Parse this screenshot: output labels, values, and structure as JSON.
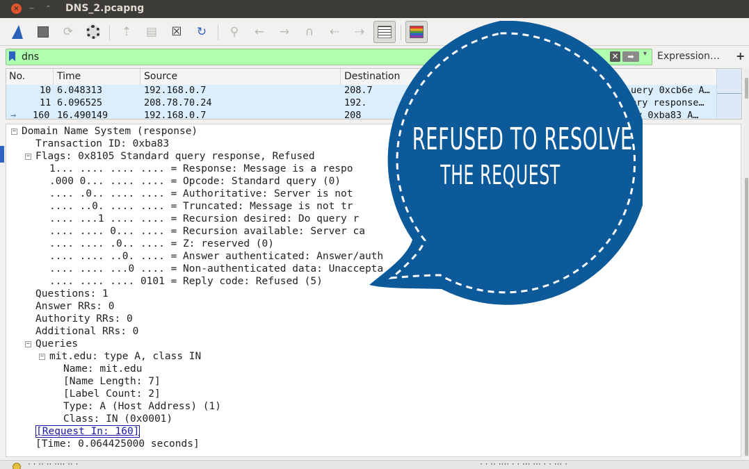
{
  "window": {
    "title": "DNS_2.pcapng",
    "close_glyph": "×",
    "min_glyph": "−",
    "max_glyph": "⌃"
  },
  "toolbar": {
    "icons": [
      "shark-fin-icon",
      "stop-icon",
      "restart-icon",
      "options-gear-icon",
      "open-file-icon",
      "save-file-icon",
      "close-file-icon",
      "reload-icon",
      "find-icon",
      "go-back-icon",
      "go-forward-icon",
      "go-to-packet-icon",
      "first-packet-icon",
      "last-packet-icon",
      "autoscroll-icon",
      "colorize-icon"
    ]
  },
  "filter": {
    "value": "dns",
    "clear_glyph": "✕",
    "apply_glyph": "➡",
    "dropdown_glyph": "▾",
    "expression_label": "Expression…",
    "add_label": "+"
  },
  "packet_list": {
    "columns": [
      "No.",
      "Time",
      "Source",
      "Destination"
    ],
    "rows": [
      {
        "no": "10",
        "time": "6.048313",
        "source": "192.168.0.7",
        "dest": "208.7",
        "info": "uery 0xcb6e A…"
      },
      {
        "no": "11",
        "time": "6.096525",
        "source": "208.78.70.24",
        "dest": "192.",
        "info": "ery response…"
      },
      {
        "no": "160",
        "time": "16.490149",
        "source": "192.168.0.7",
        "dest": "208",
        "info": "rv 0xba83 A…",
        "marker": "→"
      }
    ]
  },
  "details": {
    "lines": [
      {
        "indent": 0,
        "exp": "−",
        "text": "Domain Name System (response)"
      },
      {
        "indent": 1,
        "text": "Transaction ID: 0xba83"
      },
      {
        "indent": 1,
        "exp": "−",
        "text": "Flags: 0x8105 Standard query response, Refused"
      },
      {
        "indent": 2,
        "text": "1... .... .... .... = Response: Message is a respo"
      },
      {
        "indent": 2,
        "text": ".000 0... .... .... = Opcode: Standard query (0)"
      },
      {
        "indent": 2,
        "text": ".... .0.. .... .... = Authoritative: Server is not"
      },
      {
        "indent": 2,
        "text": ".... ..0. .... .... = Truncated: Message is not tr"
      },
      {
        "indent": 2,
        "text": ".... ...1 .... .... = Recursion desired: Do query r"
      },
      {
        "indent": 2,
        "text": ".... .... 0... .... = Recursion available: Server ca"
      },
      {
        "indent": 2,
        "text": ".... .... .0.. .... = Z: reserved (0)"
      },
      {
        "indent": 2,
        "text": ".... .... ..0. .... = Answer authenticated: Answer/auth                    ed by the server"
      },
      {
        "indent": 2,
        "text": ".... .... ...0 .... = Non-authenticated data: Unaccepta"
      },
      {
        "indent": 2,
        "text": ".... .... .... 0101 = Reply code: Refused (5)"
      },
      {
        "indent": 1,
        "text": "Questions: 1"
      },
      {
        "indent": 1,
        "text": "Answer RRs: 0"
      },
      {
        "indent": 1,
        "text": "Authority RRs: 0"
      },
      {
        "indent": 1,
        "text": "Additional RRs: 0"
      },
      {
        "indent": 1,
        "exp": "−",
        "text": "Queries"
      },
      {
        "indent": 2,
        "exp": "−",
        "text": "mit.edu: type A, class IN"
      },
      {
        "indent": 3,
        "text": "Name: mit.edu"
      },
      {
        "indent": 3,
        "text": "[Name Length: 7]"
      },
      {
        "indent": 3,
        "text": "[Label Count: 2]"
      },
      {
        "indent": 3,
        "text": "Type: A (Host Address) (1)"
      },
      {
        "indent": 3,
        "text": "Class: IN (0x0001)"
      },
      {
        "indent": 1,
        "text": "[Request In: 160]",
        "link": true
      },
      {
        "indent": 1,
        "text": "[Time: 0.064425000 seconds]"
      }
    ]
  },
  "statusbar": {
    "left_text": "· · ·· ·· ···· ·· ·",
    "right_text": "· · ·· ···· · · ··· ···   · · ··· ·"
  },
  "bubble": {
    "line1": "REFUSED TO RESOLVE",
    "line2": "THE REQUEST",
    "fill_color": "#0d5a9b",
    "dash_color": "#ffffff"
  }
}
